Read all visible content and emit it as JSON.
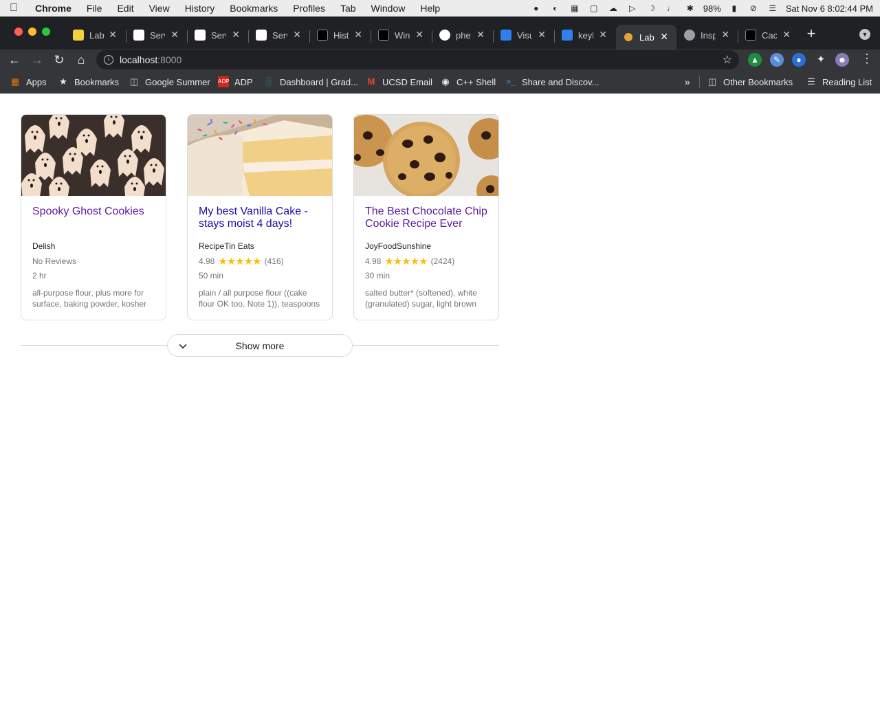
{
  "menubar": {
    "app": "Chrome",
    "items": [
      "File",
      "Edit",
      "View",
      "History",
      "Bookmarks",
      "Profiles",
      "Tab",
      "Window",
      "Help"
    ],
    "battery": "98%",
    "datetime": "Sat Nov 6  8:02:44 PM"
  },
  "tabs": [
    {
      "label": "Lab",
      "icon": "lab-icon",
      "color": "#f4d03f"
    },
    {
      "label": "Serv",
      "icon": "code-icon",
      "color": "#ffffff"
    },
    {
      "label": "Serv",
      "icon": "code-icon",
      "color": "#ffffff"
    },
    {
      "label": "Serv",
      "icon": "code-icon",
      "color": "#ffffff"
    },
    {
      "label": "Histo",
      "icon": "web-icon",
      "color": "#000000"
    },
    {
      "label": "Wind",
      "icon": "web-icon",
      "color": "#000000"
    },
    {
      "label": "phed",
      "icon": "github-icon",
      "color": "#ffffff"
    },
    {
      "label": "Visu",
      "icon": "vscode-icon",
      "color": "#2f80ed"
    },
    {
      "label": "keyb",
      "icon": "vscode-icon",
      "color": "#2f80ed"
    },
    {
      "label": "Lab",
      "icon": "cookie-icon",
      "color": "#e8a33c",
      "active": true
    },
    {
      "label": "Insp",
      "icon": "globe-icon",
      "color": "#9aa0a6"
    },
    {
      "label": "Cach",
      "icon": "web-icon",
      "color": "#000000"
    }
  ],
  "address": {
    "host": "localhost",
    "port": ":8000"
  },
  "bookmarks": {
    "items": [
      {
        "label": "Apps",
        "icon": "apps-grid-icon"
      },
      {
        "label": "Bookmarks",
        "icon": "star-icon"
      },
      {
        "label": "Google Summer",
        "icon": "folder-icon"
      },
      {
        "label": "ADP",
        "icon": "adp-icon"
      },
      {
        "label": "Dashboard | Grad...",
        "icon": "chart-icon"
      },
      {
        "label": "UCSD Email",
        "icon": "gmail-icon"
      },
      {
        "label": "C++ Shell",
        "icon": "globe-icon"
      },
      {
        "label": "Share and Discov...",
        "icon": "terminal-icon"
      }
    ],
    "other": "Other Bookmarks",
    "reading": "Reading List"
  },
  "recipes": [
    {
      "title": "Spooky Ghost Cookies",
      "visited": true,
      "source": "Delish",
      "rating": "",
      "stars": "",
      "reviews": "No Reviews",
      "time": "2 hr",
      "ingredients": "all-purpose flour, plus more for surface, baking powder, kosher"
    },
    {
      "title": "My best Vanilla Cake - stays moist 4 days!",
      "visited": false,
      "source": "RecipeTin Eats",
      "rating": "4.98",
      "stars": "★★★★★",
      "reviews": "(416)",
      "time": "50 min",
      "ingredients": "plain / all purpose flour ((cake flour OK too, Note 1)), teaspoons"
    },
    {
      "title": "The Best Chocolate Chip Cookie Recipe Ever",
      "visited": true,
      "source": "JoyFoodSunshine",
      "rating": "4.98",
      "stars": "★★★★★",
      "reviews": "(2424)",
      "time": "30 min",
      "ingredients": "salted butter* (softened), white (granulated) sugar, light brown"
    }
  ],
  "show_more": "Show more"
}
